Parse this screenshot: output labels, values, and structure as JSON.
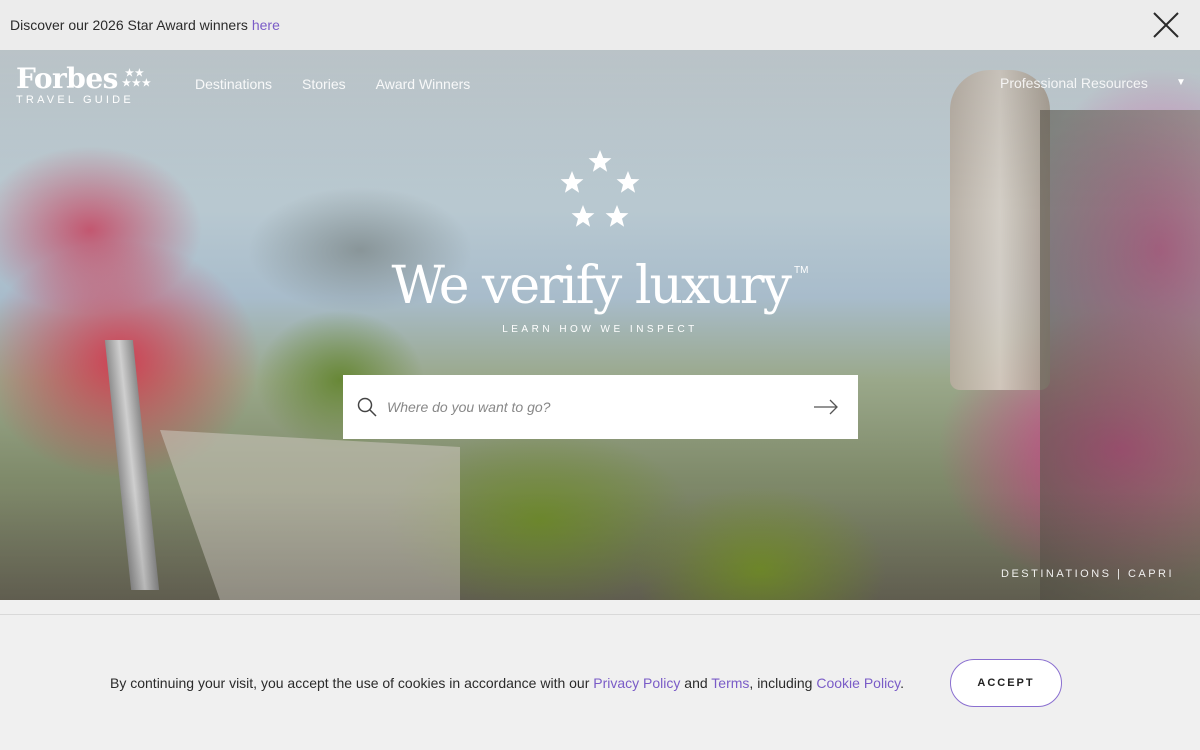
{
  "announcement": {
    "text": "Discover our 2026 Star Award winners",
    "link": "here",
    "close_icon": "close-icon"
  },
  "header": {
    "logo_brand": "Forbes",
    "logo_sub": "TRAVEL GUIDE",
    "nav": [
      "Destinations",
      "Stories",
      "Award Winners"
    ],
    "professional_resources": "Professional Resources",
    "dropdown_icon": "caret-down-icon"
  },
  "hero": {
    "tagline": "We verify luxury",
    "trademark": "TM",
    "learn_link": "LEARN HOW WE INSPECT",
    "search_placeholder": "Where do you want to go?",
    "search_icon": "search-icon",
    "submit_icon": "arrow-right-icon",
    "credit": "DESTINATIONS | CAPRI"
  },
  "cookie": {
    "text_before": "By continuing your visit, you accept the use of cookies in accordance with our ",
    "privacy_link": "Privacy Policy",
    "text_and": " and ",
    "terms_link": "Terms",
    "text_including": ", including ",
    "cookie_link": "Cookie Policy",
    "text_end": ".",
    "accept_label": "ACCEPT"
  },
  "colors": {
    "link": "#7a5cc7",
    "accept_border": "#8a6fd0"
  }
}
